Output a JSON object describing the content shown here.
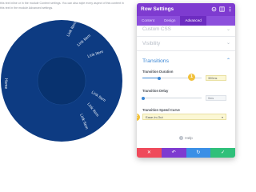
{
  "background": {
    "intro_lines": [
      "this text inline or in the module Content settings. You can also style every aspect of this content in",
      "this text in the module Advanced settings."
    ],
    "wheel_labels": [
      "Link Item",
      "Link Item",
      "Link Item",
      "Link Item",
      "Link Item",
      "Link Item",
      "Home"
    ],
    "colors": {
      "outer_ring": "#0d3b82",
      "inner_disc": "#08326f",
      "label": "#e6edf7"
    }
  },
  "panel": {
    "title": "Row Settings",
    "header_icons": [
      "focus-icon",
      "split-view-icon",
      "more-icon"
    ],
    "tabs": [
      {
        "label": "Content",
        "active": false
      },
      {
        "label": "Design",
        "active": false
      },
      {
        "label": "Advanced",
        "active": true
      }
    ],
    "sections": {
      "custom_css": "Custom CSS",
      "visibility": "Visibility",
      "transitions": "Transitions"
    },
    "transition_duration": {
      "label": "Transition Duration",
      "value": "300ms",
      "level": 0.28
    },
    "transition_delay": {
      "label": "Transition Delay",
      "value": "0ms",
      "level": 0.02
    },
    "speed_curve": {
      "label": "Transition Speed Curve",
      "value": "Ease-In-Out"
    },
    "badges": [
      "1",
      "2"
    ],
    "help": "Help",
    "footer": [
      "✕",
      "↶",
      "↻",
      "✓"
    ],
    "colors": {
      "header": "#7e3bd0",
      "accent": "#3a86d4",
      "footer": [
        "#ef4a5b",
        "#7e3bd0",
        "#3a8fe6",
        "#2fc07a"
      ],
      "badge": "#f1c13b"
    }
  }
}
